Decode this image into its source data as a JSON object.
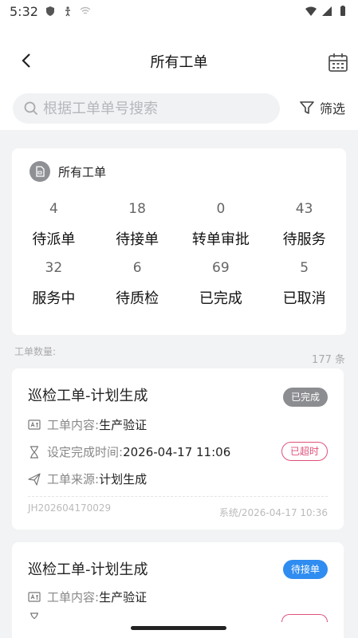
{
  "status": {
    "time": "5:32"
  },
  "nav": {
    "title": "所有工单",
    "back_icon": "chevron-left-icon",
    "calendar_icon": "calendar-icon"
  },
  "search": {
    "placeholder": "根据工单单号搜索",
    "filter_label": "筛选"
  },
  "summary": {
    "title": "所有工单",
    "cells": [
      {
        "count": "4",
        "label": "待派单"
      },
      {
        "count": "18",
        "label": "待接单"
      },
      {
        "count": "0",
        "label": "转单审批"
      },
      {
        "count": "43",
        "label": "待服务"
      },
      {
        "count": "32",
        "label": "服务中"
      },
      {
        "count": "6",
        "label": "待质检"
      },
      {
        "count": "69",
        "label": "已完成"
      },
      {
        "count": "5",
        "label": "已取消"
      }
    ]
  },
  "list_header": {
    "label": "工单数量:",
    "total": "177 条"
  },
  "orders": [
    {
      "title": "巡检工单-计划生成",
      "status": "已完成",
      "content_key": "工单内容:",
      "content_val": "生产验证",
      "due_key": "设定完成时间:",
      "due_val": "2026-04-17 11:06",
      "overdue": "已超时",
      "source_key": "工单来源:",
      "source_val": "计划生成",
      "number": "JH202604170029",
      "created": "系统/2026-04-17 10:36"
    },
    {
      "title": "巡检工单-计划生成",
      "status": "待接单",
      "content_key": "工单内容:",
      "content_val": "生产验证"
    }
  ],
  "colors": {
    "accent_blue": "#2f8cf0",
    "overdue_pink": "#e0507a",
    "done_grey": "#8c8d90"
  }
}
